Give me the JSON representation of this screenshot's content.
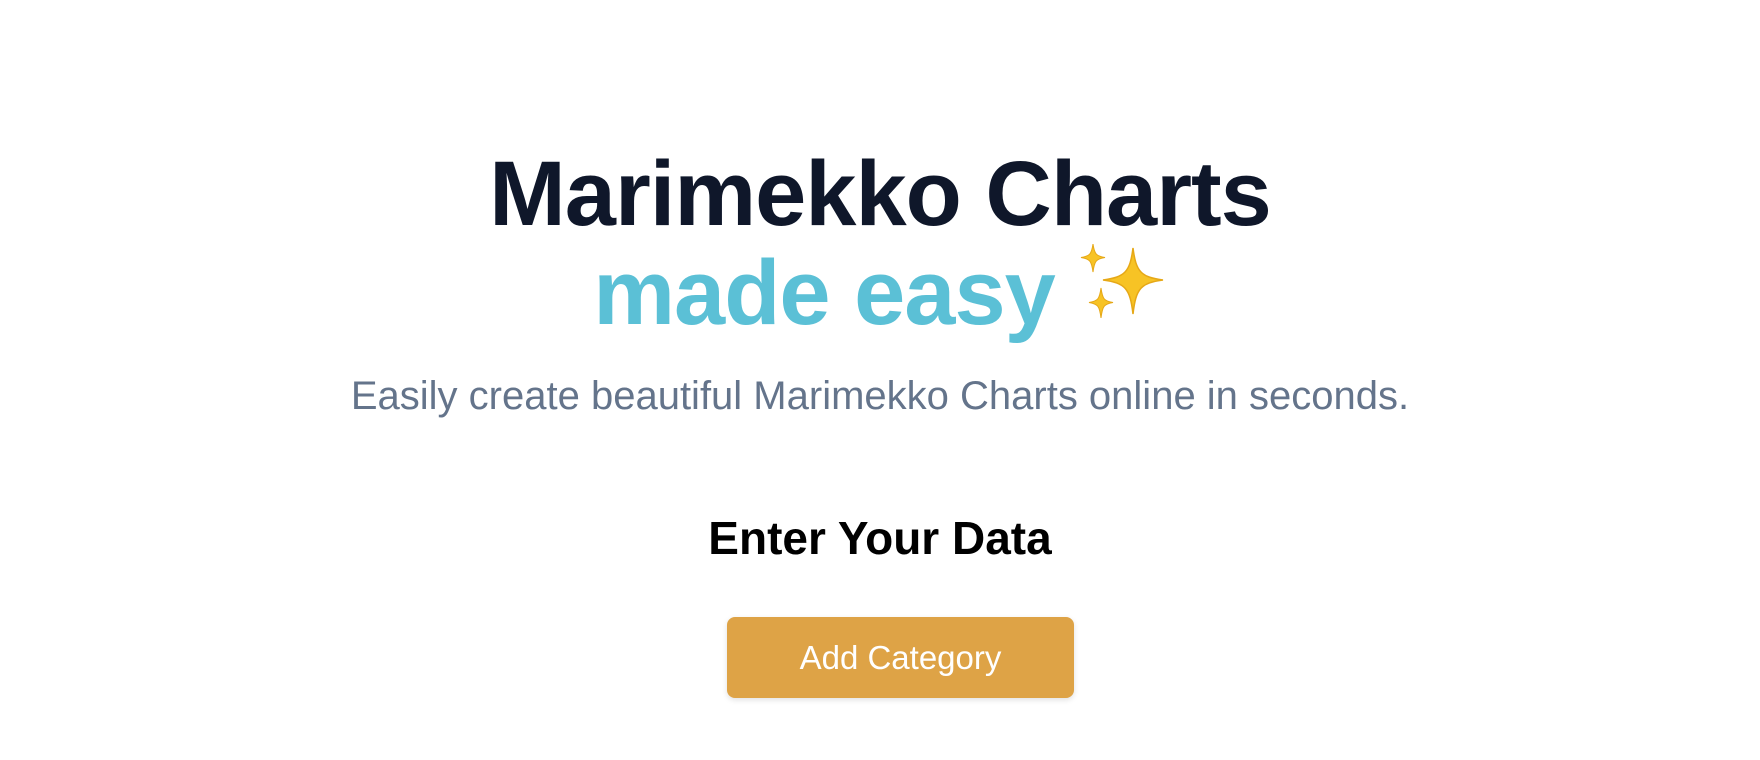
{
  "hero": {
    "title": "Marimekko Charts",
    "subtitle": "made easy",
    "sparkle_icon": "sparkles-icon",
    "tagline": "Easily create beautiful Marimekko Charts online in seconds."
  },
  "data_section": {
    "heading": "Enter Your Data",
    "add_button_label": "Add Category"
  },
  "colors": {
    "title": "#0f172a",
    "accent": "#5bc0d6",
    "tagline": "#64748b",
    "button_bg": "#dea346",
    "button_text": "#ffffff"
  }
}
